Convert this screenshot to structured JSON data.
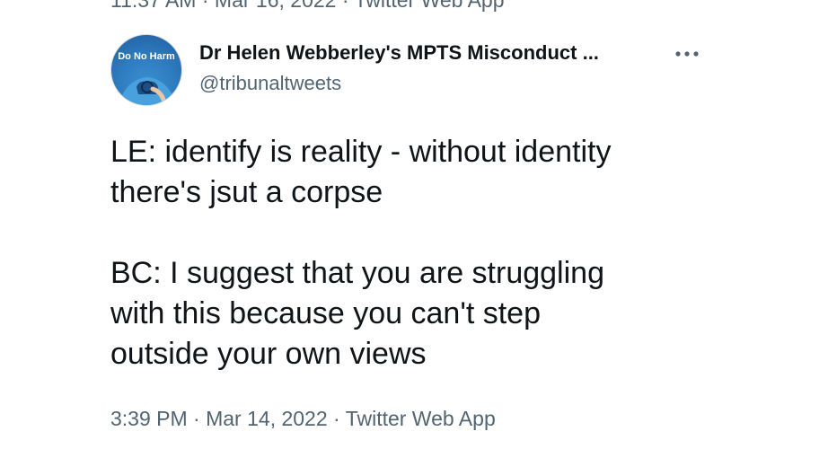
{
  "previous_tweet": {
    "meta": "11:37 AM · Mar 16, 2022 · Twitter Web App"
  },
  "tweet": {
    "avatar": {
      "text": "Do No Harm",
      "background": "#2f7cc0"
    },
    "author_name": "Dr Helen Webberley's MPTS Misconduct ...",
    "author_handle": "@tribunaltweets",
    "more_icon": "more-horizontal-icon",
    "paragraphs": [
      "LE: identify is reality - without identity\nthere's jsut a corpse",
      "BC: I suggest that you are struggling\nwith this because you can't step\noutside your own views"
    ],
    "time": "3:39 PM",
    "date": "Mar 14, 2022",
    "source": "Twitter Web App",
    "separator": "·"
  },
  "colors": {
    "text": "#0f1419",
    "secondary_text": "#536471"
  }
}
